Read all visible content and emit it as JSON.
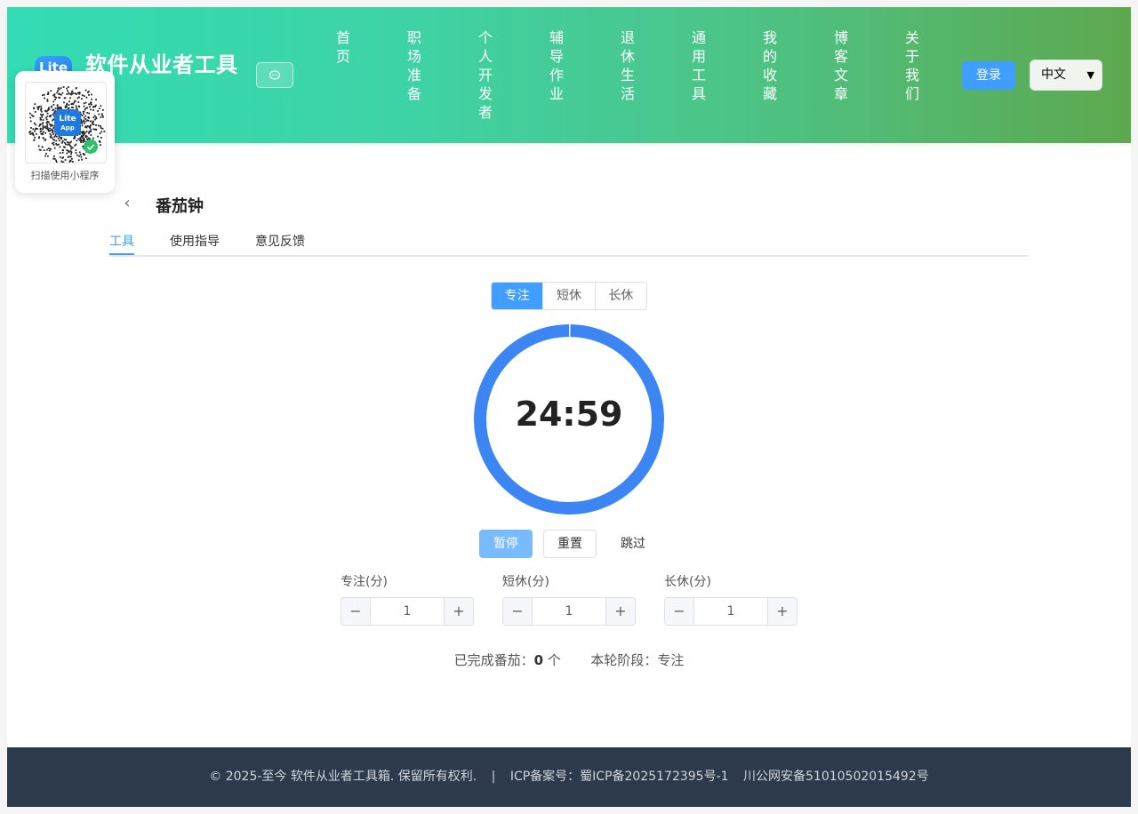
{
  "header": {
    "logo_text": "Lite",
    "site_title": "软件从业者工具",
    "chat_icon": "chat-bubble-icon",
    "nav": [
      {
        "label": "首页"
      },
      {
        "label": "职场准备"
      },
      {
        "label": "个人开发者"
      },
      {
        "label": "辅导作业"
      },
      {
        "label": "退休生活"
      },
      {
        "label": "通用工具"
      },
      {
        "label": "我的收藏"
      },
      {
        "label": "博客文章"
      },
      {
        "label": "关于我们"
      }
    ],
    "login_label": "登录",
    "language": "中文"
  },
  "qr": {
    "app_label": "Lite App",
    "caption": "扫描使用小程序"
  },
  "tool": {
    "title": "番茄钟",
    "tabs": [
      {
        "label": "工具",
        "active": true
      },
      {
        "label": "使用指导",
        "active": false
      },
      {
        "label": "意见反馈",
        "active": false
      }
    ],
    "modes": [
      {
        "label": "专注",
        "active": true
      },
      {
        "label": "短休",
        "active": false
      },
      {
        "label": "长休",
        "active": false
      }
    ],
    "timer": "24:59",
    "progress_fraction": 0.0007,
    "ring_color": "#3b86f3",
    "controls": {
      "pause": "暂停",
      "reset": "重置",
      "skip": "跳过"
    },
    "settings": [
      {
        "label": "专注(分)",
        "value": "1"
      },
      {
        "label": "短休(分)",
        "value": "1"
      },
      {
        "label": "长休(分)",
        "value": "1"
      }
    ],
    "status": {
      "completed_prefix": "已完成番茄：",
      "completed_count": "0",
      "completed_suffix": " 个",
      "phase_prefix": "本轮阶段：",
      "phase": "专注"
    }
  },
  "footer": {
    "copyright": "© 2025-至今 软件从业者工具箱. 保留所有权利.",
    "separator": "|",
    "icp": "ICP备案号：蜀ICP备2025172395号-1",
    "police": "川公网安备51010502015492号"
  }
}
